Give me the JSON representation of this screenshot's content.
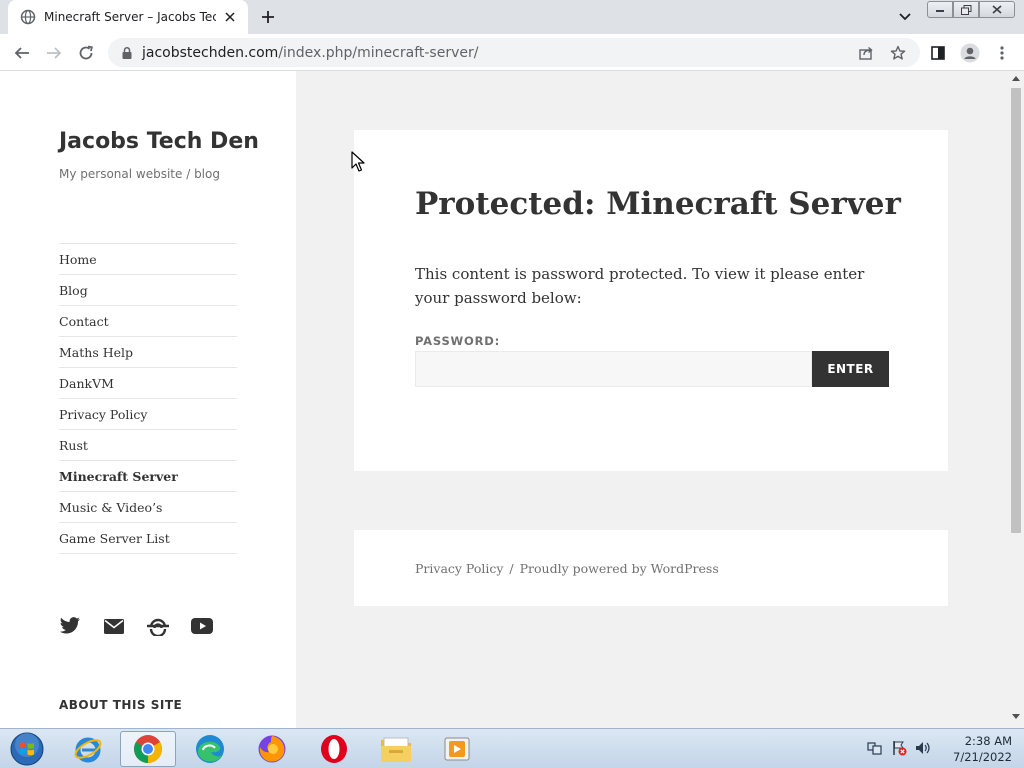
{
  "browser": {
    "tab_title": "Minecraft Server – Jacobs Tech D",
    "url_domain": "jacobstechden.com",
    "url_path": "/index.php/minecraft-server/"
  },
  "site": {
    "title": "Jacobs Tech Den",
    "description": "My personal website / blog",
    "menu": [
      {
        "label": "Home"
      },
      {
        "label": "Blog"
      },
      {
        "label": "Contact"
      },
      {
        "label": "Maths Help"
      },
      {
        "label": "DankVM"
      },
      {
        "label": "Privacy Policy"
      },
      {
        "label": "Rust"
      },
      {
        "label": "Minecraft Server",
        "current": true
      },
      {
        "label": "Music & Video’s"
      },
      {
        "label": "Game Server List"
      }
    ],
    "social_icons": [
      "twitter-icon",
      "mail-icon",
      "link-icon",
      "youtube-icon"
    ],
    "about_heading": "ABOUT THIS SITE"
  },
  "article": {
    "title": "Protected: Minecraft Server",
    "text": "This content is password protected. To view it please enter your password below:",
    "password_label": "PASSWORD:",
    "password_value": "",
    "enter_label": "ENTER"
  },
  "footer": {
    "privacy_link": "Privacy Policy",
    "separator": "/",
    "powered_by": "Proudly powered by WordPress"
  },
  "taskbar": {
    "apps": [
      "internet-explorer-icon",
      "chrome-icon",
      "edge-icon",
      "firefox-icon",
      "opera-icon",
      "file-explorer-icon",
      "media-player-icon"
    ],
    "time": "2:38 AM",
    "date": "7/21/2022"
  },
  "colors": {
    "page_bg": "#f1f1f1",
    "text": "#333333",
    "muted": "#707070",
    "button_bg": "#333333"
  }
}
